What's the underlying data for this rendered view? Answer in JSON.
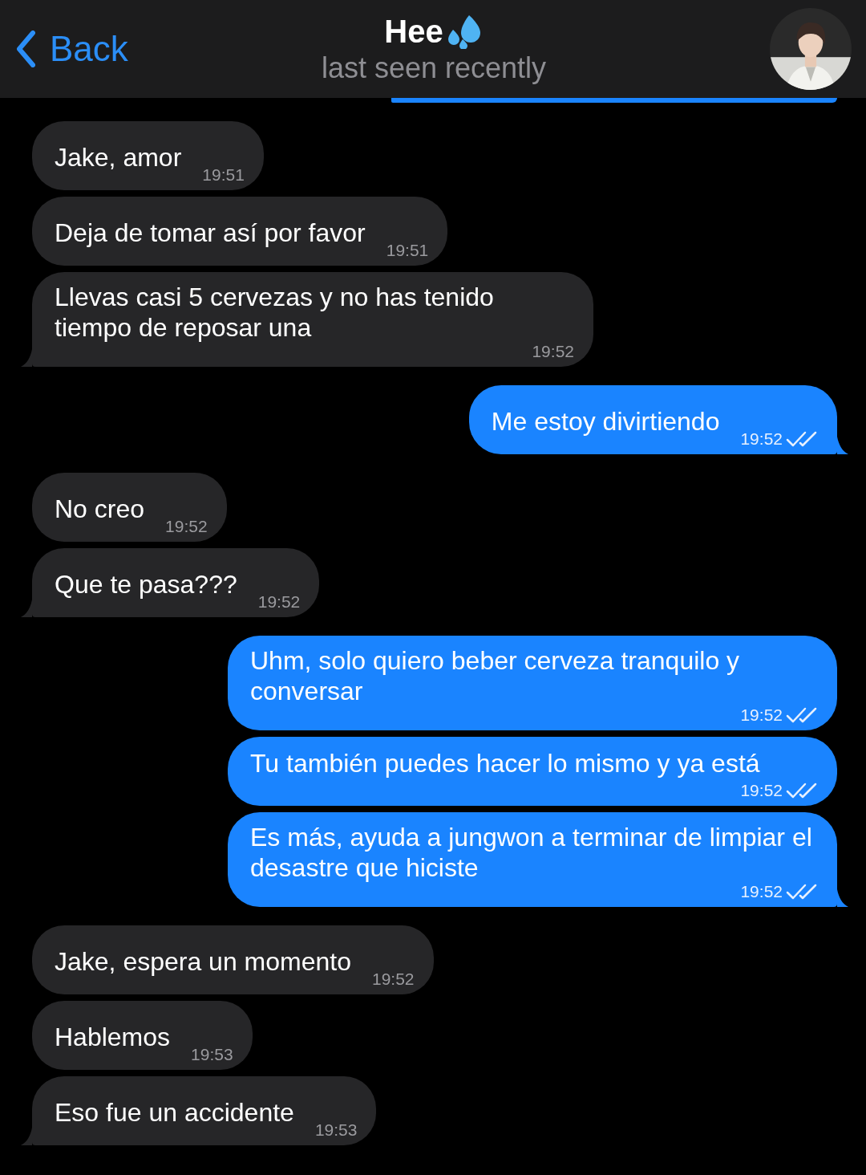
{
  "header": {
    "back": "Back",
    "title": "Hee",
    "status": "last seen recently"
  },
  "messages": [
    {
      "kind": "outgoing",
      "partial": true
    },
    {
      "kind": "incoming",
      "text": "Jake, amor",
      "time": "19:51"
    },
    {
      "kind": "incoming",
      "text": "Deja de tomar así por favor",
      "time": "19:51"
    },
    {
      "kind": "incoming",
      "text": "Llevas casi 5 cervezas y no has tenido tiempo de reposar una",
      "time": "19:52"
    },
    {
      "kind": "outgoing",
      "text": "Me estoy divirtiendo",
      "time": "19:52",
      "read": true
    },
    {
      "kind": "incoming",
      "text": "No creo",
      "time": "19:52"
    },
    {
      "kind": "incoming",
      "text": "Que te pasa???",
      "time": "19:52"
    },
    {
      "kind": "outgoing",
      "text": "Uhm, solo quiero beber cerveza tranquilo y conversar",
      "time": "19:52",
      "read": true
    },
    {
      "kind": "outgoing",
      "text": "Tu también puedes hacer lo mismo y ya está",
      "time": "19:52",
      "read": true
    },
    {
      "kind": "outgoing",
      "text": "Es más, ayuda a jungwon a terminar de limpiar el desastre que hiciste",
      "time": "19:52",
      "read": true
    },
    {
      "kind": "incoming",
      "text": "Jake, espera un momento",
      "time": "19:52"
    },
    {
      "kind": "incoming",
      "text": "Hablemos",
      "time": "19:53"
    },
    {
      "kind": "incoming",
      "text": "Eso fue un accidente",
      "time": "19:53"
    }
  ]
}
